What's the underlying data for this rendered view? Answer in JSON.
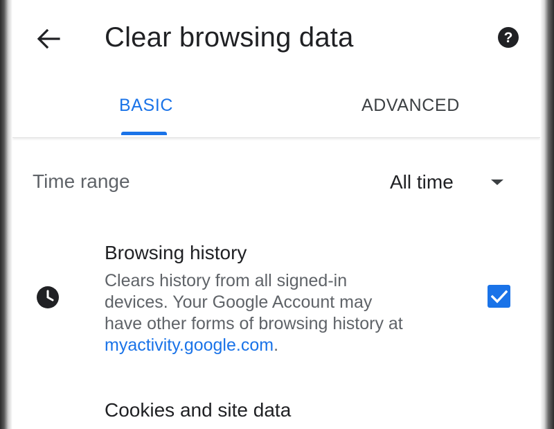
{
  "header": {
    "title": "Clear browsing data",
    "back_icon": "arrow-back-icon",
    "help_icon": "help-icon"
  },
  "tabs": [
    {
      "label": "BASIC",
      "selected": true
    },
    {
      "label": "ADVANCED",
      "selected": false
    }
  ],
  "time_range": {
    "label": "Time range",
    "value": "All time",
    "icon": "dropdown-arrow-icon"
  },
  "items": [
    {
      "title": "Browsing history",
      "icon": "clock-icon",
      "description_line1": "Clears history from all signed-in",
      "description_line2": "devices. Your Google Account may",
      "description_line3": "have other forms of browsing history at",
      "link": "myactivity.google.com",
      "link_suffix": ".",
      "checked": true
    },
    {
      "title": "Cookies and site data"
    }
  ],
  "colors": {
    "accent": "#1a73e8",
    "text_primary": "#202124",
    "text_secondary": "#5f6368"
  }
}
